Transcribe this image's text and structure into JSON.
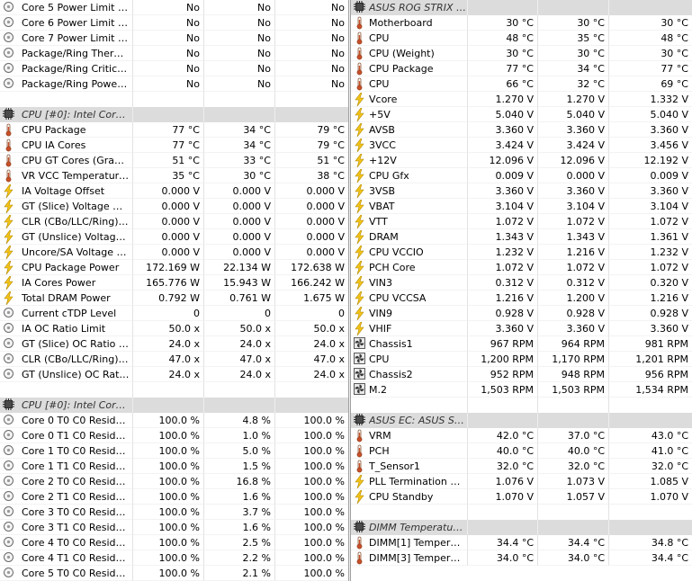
{
  "left_rows": [
    {
      "type": "sensor",
      "icon": "circle",
      "label": "Core 5 Power Limit Ex...",
      "v": [
        "No",
        "No",
        "No"
      ]
    },
    {
      "type": "sensor",
      "icon": "circle",
      "label": "Core 6 Power Limit Ex...",
      "v": [
        "No",
        "No",
        "No"
      ]
    },
    {
      "type": "sensor",
      "icon": "circle",
      "label": "Core 7 Power Limit Ex...",
      "v": [
        "No",
        "No",
        "No"
      ]
    },
    {
      "type": "sensor",
      "icon": "circle",
      "label": "Package/Ring Thermal...",
      "v": [
        "No",
        "No",
        "No"
      ]
    },
    {
      "type": "sensor",
      "icon": "circle",
      "label": "Package/Ring Critical ...",
      "v": [
        "No",
        "No",
        "No"
      ]
    },
    {
      "type": "sensor",
      "icon": "circle",
      "label": "Package/Ring Power L...",
      "v": [
        "No",
        "No",
        "No"
      ]
    },
    {
      "type": "blank"
    },
    {
      "type": "header",
      "icon": "chip",
      "label": "CPU [#0]: Intel Core i..."
    },
    {
      "type": "sensor",
      "icon": "thermo",
      "label": "CPU Package",
      "v": [
        "77 °C",
        "34 °C",
        "79 °C"
      ]
    },
    {
      "type": "sensor",
      "icon": "thermo",
      "label": "CPU IA Cores",
      "v": [
        "77 °C",
        "34 °C",
        "79 °C"
      ]
    },
    {
      "type": "sensor",
      "icon": "thermo",
      "label": "CPU GT Cores (Graphics)",
      "v": [
        "51 °C",
        "33 °C",
        "51 °C"
      ]
    },
    {
      "type": "sensor",
      "icon": "thermo",
      "label": "VR VCC Temperature ...",
      "v": [
        "35 °C",
        "30 °C",
        "38 °C"
      ]
    },
    {
      "type": "sensor",
      "icon": "bolt",
      "label": "IA Voltage Offset",
      "v": [
        "0.000 V",
        "0.000 V",
        "0.000 V"
      ]
    },
    {
      "type": "sensor",
      "icon": "bolt",
      "label": "GT (Slice) Voltage Offset",
      "v": [
        "0.000 V",
        "0.000 V",
        "0.000 V"
      ]
    },
    {
      "type": "sensor",
      "icon": "bolt",
      "label": "CLR (CBo/LLC/Ring) V...",
      "v": [
        "0.000 V",
        "0.000 V",
        "0.000 V"
      ]
    },
    {
      "type": "sensor",
      "icon": "bolt",
      "label": "GT (Unslice) Voltage O...",
      "v": [
        "0.000 V",
        "0.000 V",
        "0.000 V"
      ]
    },
    {
      "type": "sensor",
      "icon": "bolt",
      "label": "Uncore/SA Voltage Of...",
      "v": [
        "0.000 V",
        "0.000 V",
        "0.000 V"
      ]
    },
    {
      "type": "sensor",
      "icon": "bolt",
      "label": "CPU Package Power",
      "v": [
        "172.169 W",
        "22.134 W",
        "172.638 W"
      ]
    },
    {
      "type": "sensor",
      "icon": "bolt",
      "label": "IA Cores Power",
      "v": [
        "165.776 W",
        "15.943 W",
        "166.242 W"
      ]
    },
    {
      "type": "sensor",
      "icon": "bolt",
      "label": "Total DRAM Power",
      "v": [
        "0.792 W",
        "0.761 W",
        "1.675 W"
      ]
    },
    {
      "type": "sensor",
      "icon": "circle",
      "label": "Current cTDP Level",
      "v": [
        "0",
        "0",
        "0"
      ]
    },
    {
      "type": "sensor",
      "icon": "circle",
      "label": "IA OC Ratio Limit",
      "v": [
        "50.0 x",
        "50.0 x",
        "50.0 x"
      ]
    },
    {
      "type": "sensor",
      "icon": "circle",
      "label": "GT (Slice) OC Ratio Limit",
      "v": [
        "24.0 x",
        "24.0 x",
        "24.0 x"
      ]
    },
    {
      "type": "sensor",
      "icon": "circle",
      "label": "CLR (CBo/LLC/Ring) O...",
      "v": [
        "47.0 x",
        "47.0 x",
        "47.0 x"
      ]
    },
    {
      "type": "sensor",
      "icon": "circle",
      "label": "GT (Unslice) OC Ratio ...",
      "v": [
        "24.0 x",
        "24.0 x",
        "24.0 x"
      ]
    },
    {
      "type": "blank"
    },
    {
      "type": "header",
      "icon": "chip",
      "label": "CPU [#0]: Intel Core i..."
    },
    {
      "type": "sensor",
      "icon": "circle",
      "label": "Core 0 T0 C0 Residency",
      "v": [
        "100.0 %",
        "4.8 %",
        "100.0 %"
      ]
    },
    {
      "type": "sensor",
      "icon": "circle",
      "label": "Core 0 T1 C0 Residency",
      "v": [
        "100.0 %",
        "1.0 %",
        "100.0 %"
      ]
    },
    {
      "type": "sensor",
      "icon": "circle",
      "label": "Core 1 T0 C0 Residency",
      "v": [
        "100.0 %",
        "5.0 %",
        "100.0 %"
      ]
    },
    {
      "type": "sensor",
      "icon": "circle",
      "label": "Core 1 T1 C0 Residency",
      "v": [
        "100.0 %",
        "1.5 %",
        "100.0 %"
      ]
    },
    {
      "type": "sensor",
      "icon": "circle",
      "label": "Core 2 T0 C0 Residency",
      "v": [
        "100.0 %",
        "16.8 %",
        "100.0 %"
      ]
    },
    {
      "type": "sensor",
      "icon": "circle",
      "label": "Core 2 T1 C0 Residency",
      "v": [
        "100.0 %",
        "1.6 %",
        "100.0 %"
      ]
    },
    {
      "type": "sensor",
      "icon": "circle",
      "label": "Core 3 T0 C0 Residency",
      "v": [
        "100.0 %",
        "3.7 %",
        "100.0 %"
      ]
    },
    {
      "type": "sensor",
      "icon": "circle",
      "label": "Core 3 T1 C0 Residency",
      "v": [
        "100.0 %",
        "1.6 %",
        "100.0 %"
      ]
    },
    {
      "type": "sensor",
      "icon": "circle",
      "label": "Core 4 T0 C0 Residency",
      "v": [
        "100.0 %",
        "2.5 %",
        "100.0 %"
      ]
    },
    {
      "type": "sensor",
      "icon": "circle",
      "label": "Core 4 T1 C0 Residency",
      "v": [
        "100.0 %",
        "2.2 %",
        "100.0 %"
      ]
    },
    {
      "type": "sensor",
      "icon": "circle",
      "label": "Core 5 T0 C0 Residency",
      "v": [
        "100.0 %",
        "2.1 %",
        "100.0 %"
      ]
    }
  ],
  "right_rows": [
    {
      "type": "header",
      "icon": "chip",
      "label": "ASUS ROG STRIX Z..."
    },
    {
      "type": "sensor",
      "icon": "thermo",
      "label": "Motherboard",
      "v": [
        "30 °C",
        "30 °C",
        "30 °C"
      ]
    },
    {
      "type": "sensor",
      "icon": "thermo",
      "label": "CPU",
      "v": [
        "48 °C",
        "35 °C",
        "48 °C"
      ]
    },
    {
      "type": "sensor",
      "icon": "thermo",
      "label": "CPU (Weight)",
      "v": [
        "30 °C",
        "30 °C",
        "30 °C"
      ]
    },
    {
      "type": "sensor",
      "icon": "thermo",
      "label": "CPU Package",
      "v": [
        "77 °C",
        "34 °C",
        "77 °C"
      ]
    },
    {
      "type": "sensor",
      "icon": "thermo",
      "label": "CPU",
      "v": [
        "66 °C",
        "32 °C",
        "69 °C"
      ]
    },
    {
      "type": "sensor",
      "icon": "bolt",
      "label": "Vcore",
      "v": [
        "1.270 V",
        "1.270 V",
        "1.332 V"
      ]
    },
    {
      "type": "sensor",
      "icon": "bolt",
      "label": "+5V",
      "v": [
        "5.040 V",
        "5.040 V",
        "5.040 V"
      ]
    },
    {
      "type": "sensor",
      "icon": "bolt",
      "label": "AVSB",
      "v": [
        "3.360 V",
        "3.360 V",
        "3.360 V"
      ]
    },
    {
      "type": "sensor",
      "icon": "bolt",
      "label": "3VCC",
      "v": [
        "3.424 V",
        "3.424 V",
        "3.456 V"
      ]
    },
    {
      "type": "sensor",
      "icon": "bolt",
      "label": "+12V",
      "v": [
        "12.096 V",
        "12.096 V",
        "12.192 V"
      ]
    },
    {
      "type": "sensor",
      "icon": "bolt",
      "label": "CPU Gfx",
      "v": [
        "0.009 V",
        "0.000 V",
        "0.009 V"
      ]
    },
    {
      "type": "sensor",
      "icon": "bolt",
      "label": "3VSB",
      "v": [
        "3.360 V",
        "3.360 V",
        "3.360 V"
      ]
    },
    {
      "type": "sensor",
      "icon": "bolt",
      "label": "VBAT",
      "v": [
        "3.104 V",
        "3.104 V",
        "3.104 V"
      ]
    },
    {
      "type": "sensor",
      "icon": "bolt",
      "label": "VTT",
      "v": [
        "1.072 V",
        "1.072 V",
        "1.072 V"
      ]
    },
    {
      "type": "sensor",
      "icon": "bolt",
      "label": "DRAM",
      "v": [
        "1.343 V",
        "1.343 V",
        "1.361 V"
      ]
    },
    {
      "type": "sensor",
      "icon": "bolt",
      "label": "CPU VCCIO",
      "v": [
        "1.232 V",
        "1.216 V",
        "1.232 V"
      ]
    },
    {
      "type": "sensor",
      "icon": "bolt",
      "label": "PCH Core",
      "v": [
        "1.072 V",
        "1.072 V",
        "1.072 V"
      ]
    },
    {
      "type": "sensor",
      "icon": "bolt",
      "label": "VIN3",
      "v": [
        "0.312 V",
        "0.312 V",
        "0.320 V"
      ]
    },
    {
      "type": "sensor",
      "icon": "bolt",
      "label": "CPU VCCSA",
      "v": [
        "1.216 V",
        "1.200 V",
        "1.216 V"
      ]
    },
    {
      "type": "sensor",
      "icon": "bolt",
      "label": "VIN9",
      "v": [
        "0.928 V",
        "0.928 V",
        "0.928 V"
      ]
    },
    {
      "type": "sensor",
      "icon": "bolt",
      "label": "VHIF",
      "v": [
        "3.360 V",
        "3.360 V",
        "3.360 V"
      ]
    },
    {
      "type": "sensor",
      "icon": "fan",
      "label": "Chassis1",
      "v": [
        "967 RPM",
        "964 RPM",
        "981 RPM"
      ]
    },
    {
      "type": "sensor",
      "icon": "fan",
      "label": "CPU",
      "v": [
        "1,200 RPM",
        "1,170 RPM",
        "1,201 RPM"
      ]
    },
    {
      "type": "sensor",
      "icon": "fan",
      "label": "Chassis2",
      "v": [
        "952 RPM",
        "948 RPM",
        "956 RPM"
      ]
    },
    {
      "type": "sensor",
      "icon": "fan",
      "label": "M.2",
      "v": [
        "1,503 RPM",
        "1,503 RPM",
        "1,534 RPM"
      ]
    },
    {
      "type": "blank"
    },
    {
      "type": "header",
      "icon": "chip",
      "label": "ASUS EC: ASUS Sys..."
    },
    {
      "type": "sensor",
      "icon": "thermo",
      "label": "VRM",
      "v": [
        "42.0 °C",
        "37.0 °C",
        "43.0 °C"
      ]
    },
    {
      "type": "sensor",
      "icon": "thermo",
      "label": "PCH",
      "v": [
        "40.0 °C",
        "40.0 °C",
        "41.0 °C"
      ]
    },
    {
      "type": "sensor",
      "icon": "thermo",
      "label": "T_Sensor1",
      "v": [
        "32.0 °C",
        "32.0 °C",
        "32.0 °C"
      ]
    },
    {
      "type": "sensor",
      "icon": "bolt",
      "label": "PLL Termination Vol...",
      "v": [
        "1.076 V",
        "1.073 V",
        "1.085 V"
      ]
    },
    {
      "type": "sensor",
      "icon": "bolt",
      "label": "CPU Standby",
      "v": [
        "1.070 V",
        "1.057 V",
        "1.070 V"
      ]
    },
    {
      "type": "blank"
    },
    {
      "type": "header",
      "icon": "chip",
      "label": "DIMM Temperature ..."
    },
    {
      "type": "sensor",
      "icon": "thermo",
      "label": "DIMM[1] Temperature",
      "v": [
        "34.4 °C",
        "34.4 °C",
        "34.8 °C"
      ]
    },
    {
      "type": "sensor",
      "icon": "thermo",
      "label": "DIMM[3] Temperature",
      "v": [
        "34.0 °C",
        "34.0 °C",
        "34.4 °C"
      ]
    }
  ],
  "icon_names": {
    "circle": "gauge-circle-icon",
    "thermo": "thermometer-icon",
    "bolt": "lightning-bolt-icon",
    "fan": "fan-icon",
    "chip": "chip-icon"
  },
  "colors": {
    "header_bg": "#dcdcdc",
    "bolt_yellow": "#f5c518",
    "thermo_red": "#c8502a"
  }
}
